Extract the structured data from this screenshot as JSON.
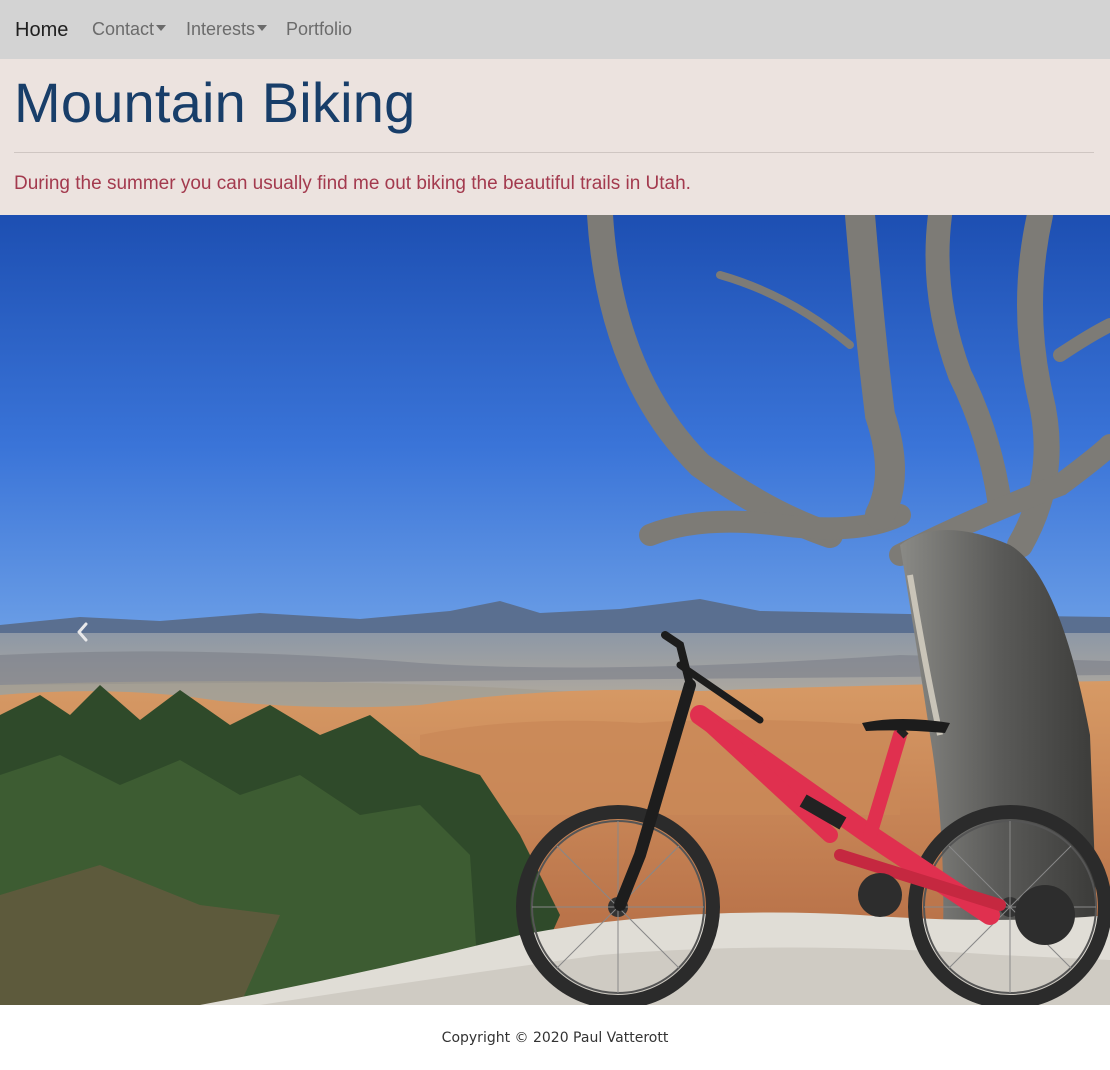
{
  "nav": {
    "home": "Home",
    "contact": "Contact",
    "interests": "Interests",
    "portfolio": "Portfolio"
  },
  "header": {
    "title": "Mountain Biking",
    "lead": "During the summer you can usually find me out biking the beautiful trails in Utah."
  },
  "carousel": {
    "prev_icon": "chevron-left-icon",
    "image_subject": "red mountain bike beside dead tree overlooking red rock canyon"
  },
  "footer": {
    "copyright": "Copyright © 2020 Paul Vatterott"
  },
  "colors": {
    "navbar_bg": "#d3d3d3",
    "header_bg": "#ece3df",
    "title": "#183e69",
    "lead": "#a33a4e"
  }
}
